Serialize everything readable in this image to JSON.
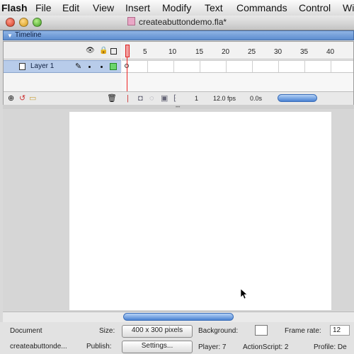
{
  "menubar": {
    "app_name": "Flash",
    "items": [
      "File",
      "Edit",
      "View",
      "Insert",
      "Modify",
      "Text",
      "Commands",
      "Control",
      "Wi"
    ]
  },
  "window": {
    "title": "createabuttondemo.fla*"
  },
  "timeline": {
    "panel_title": "Timeline",
    "layer_name": "Layer 1",
    "ruler_ticks": [
      "1",
      "5",
      "10",
      "15",
      "20",
      "25",
      "30",
      "35",
      "40"
    ],
    "current_frame": "1",
    "frame_rate_display": "12.0 fps",
    "elapsed_time": "0.0s"
  },
  "properties": {
    "document_label": "Document",
    "document_name": "createabuttonde...",
    "size_label": "Size:",
    "size_value": "400 x 300 pixels",
    "background_label": "Background:",
    "frame_rate_label": "Frame rate:",
    "frame_rate_value": "12",
    "publish_label": "Publish:",
    "settings_button": "Settings...",
    "player_label": "Player: 7",
    "actionscript_label": "ActionScript: 2",
    "profile_label": "Profile: De"
  },
  "colors": {
    "timeline_header": "#5e8dd0",
    "layer_selected": "#b8ccea",
    "playhead": "#dd2222",
    "stage": "#ffffff",
    "workspace": "#d6d6d6"
  }
}
